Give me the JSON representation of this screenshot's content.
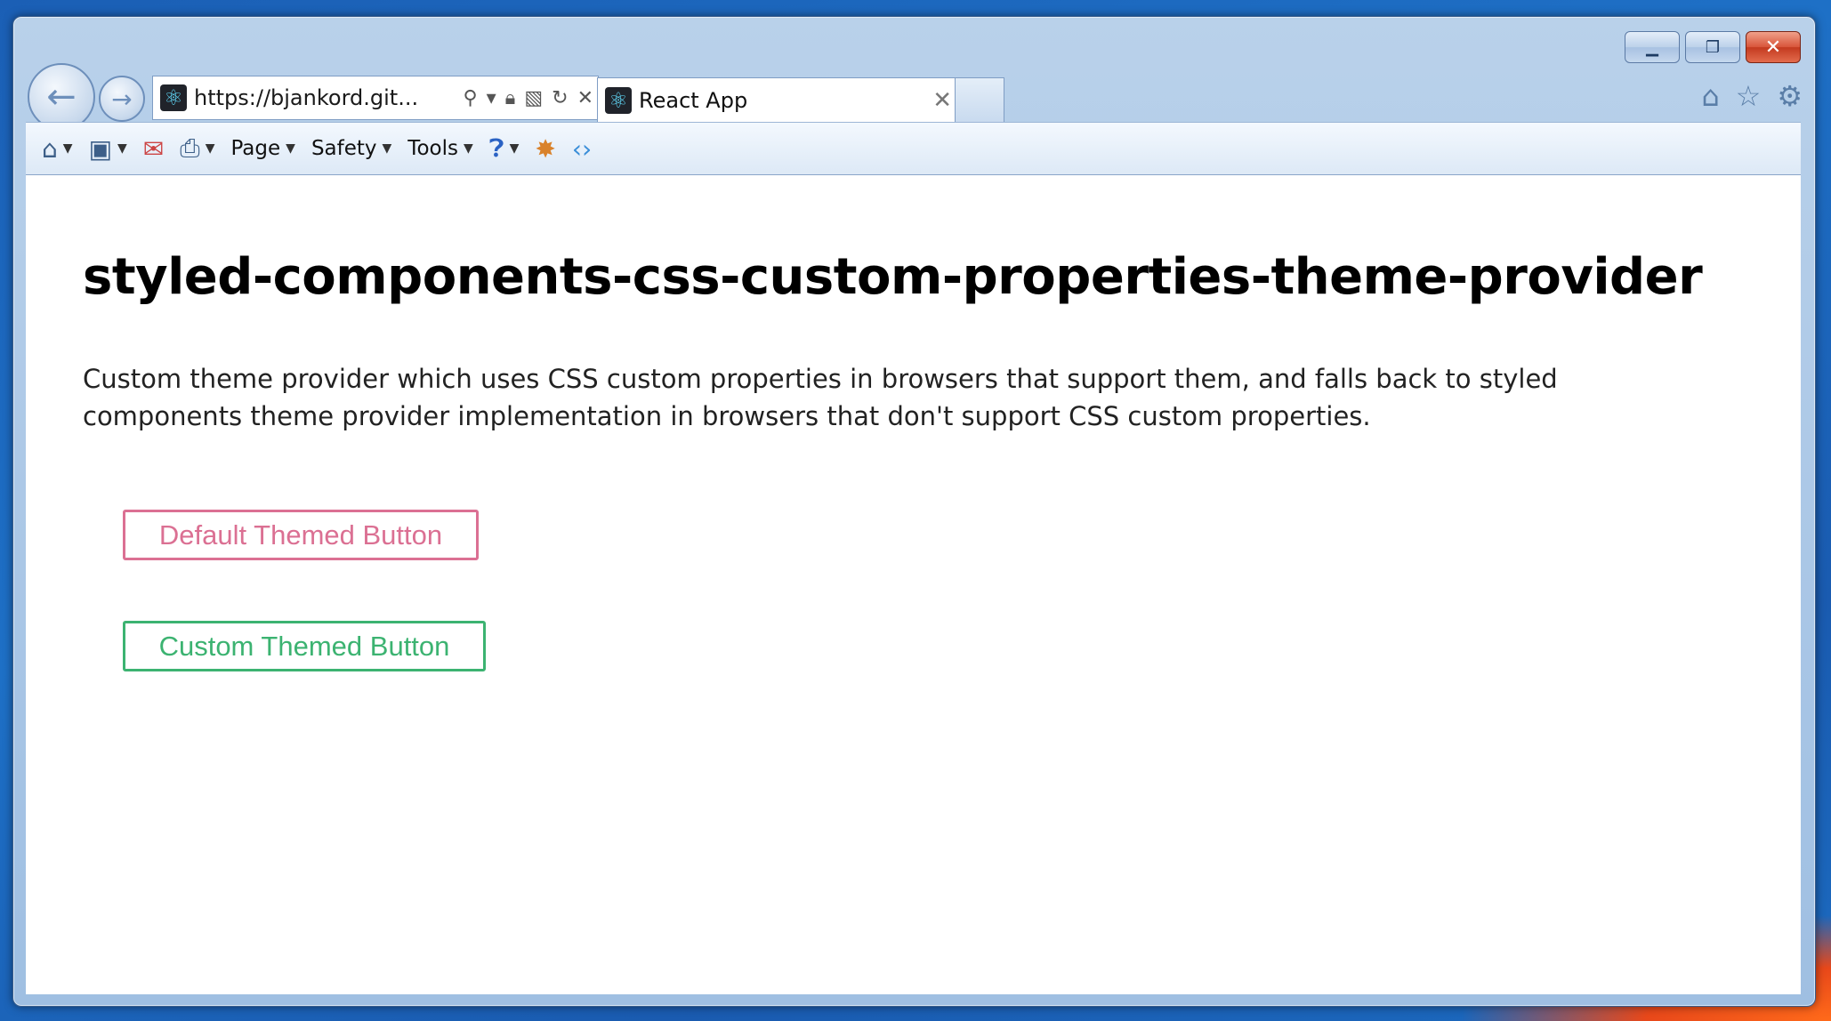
{
  "browser": {
    "address": "https://bjankord.git...",
    "tab_title": "React App",
    "tab_close": "✕",
    "commands": {
      "page": "Page",
      "safety": "Safety",
      "tools": "Tools"
    }
  },
  "page": {
    "title": "styled-components-css-custom-properties-theme-provider",
    "description": "Custom theme provider which uses CSS custom properties in browsers that support them, and falls back to styled components theme provider implementation in browsers that don't support CSS custom properties.",
    "buttons": [
      {
        "label": "Default Themed Button",
        "color": "#db7093"
      },
      {
        "label": "Custom Themed Button",
        "color": "#3cb371"
      }
    ]
  },
  "colors": {
    "default_button": "#db7093",
    "custom_button": "#3cb371"
  },
  "icons": {
    "back": "back-arrow-icon",
    "forward": "forward-arrow-icon",
    "home": "home-icon",
    "favorites": "star-icon",
    "settings": "gear-icon"
  }
}
